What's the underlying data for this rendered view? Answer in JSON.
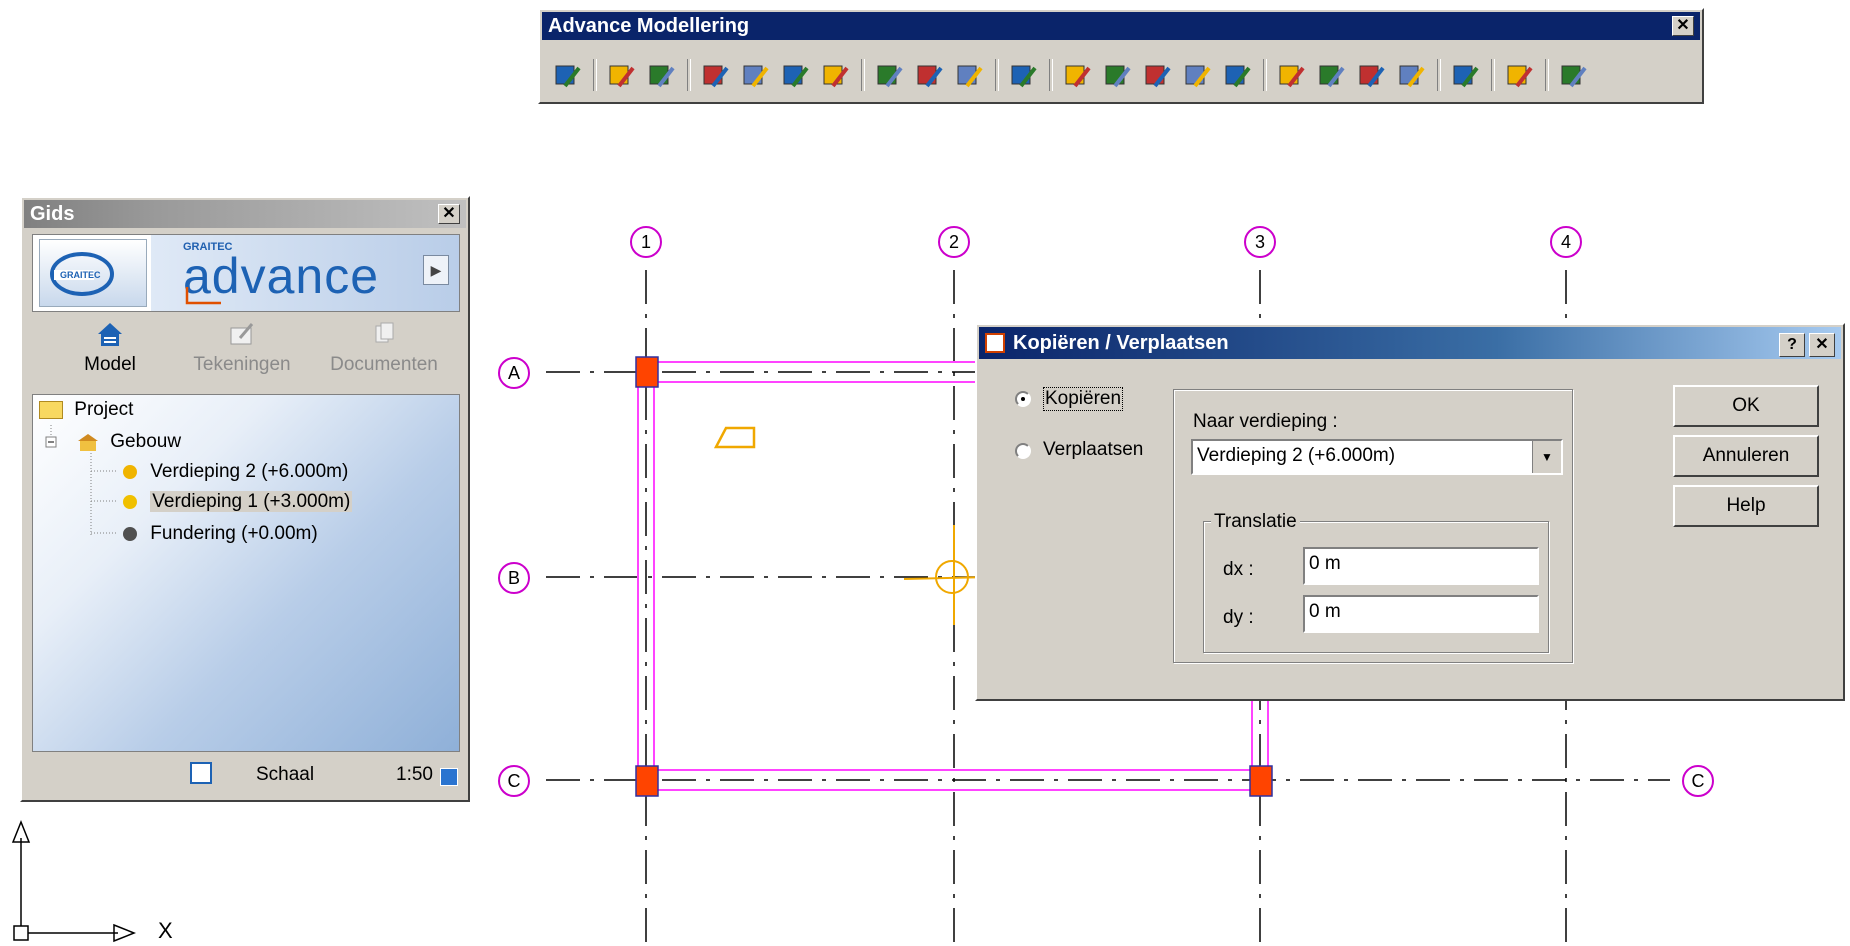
{
  "toolbar": {
    "title": "Advance Modellering",
    "icons": [
      "properties-icon",
      "model-icon",
      "layers-icon",
      "grid-icon",
      "column-icon",
      "beam-icon",
      "wall-icon",
      "roof-icon",
      "slab-icon",
      "foundation-icon",
      "line-load-icon",
      "connect-icon",
      "trim-icon",
      "align-icon",
      "extend-icon",
      "cut-icon",
      "opening-icon",
      "copy-icon",
      "section-icon",
      "stair-icon",
      "house-icon",
      "refresh-icon",
      "check-icon"
    ]
  },
  "gids": {
    "title": "Gids",
    "brand_small": "GRAITEC",
    "brand_big": "advance",
    "tabs": [
      {
        "label": "Model",
        "icon": "model-building-icon"
      },
      {
        "label": "Tekeningen",
        "icon": "drawings-icon"
      },
      {
        "label": "Documenten",
        "icon": "documents-icon"
      }
    ],
    "tree": {
      "project": "Project",
      "gebouw": "Gebouw",
      "levels": [
        {
          "label": "Verdieping 2 (+6.000m)",
          "dot": "#f0b400"
        },
        {
          "label": "Verdieping 1 (+3.000m)",
          "dot": "#f0c000"
        },
        {
          "label": "Fundering (+0.00m)",
          "dot": "#505050"
        }
      ]
    },
    "schaal_label": "Schaal",
    "schaal_value": "1:50"
  },
  "drawing": {
    "columns": [
      "1",
      "2",
      "3",
      "4"
    ],
    "rows": [
      "A",
      "B",
      "C"
    ],
    "row_right": "C",
    "ucs_label": "X",
    "grid_color": "#cc00cc",
    "beam_color": "#ff44ff",
    "column_fill": "#ff4400"
  },
  "dialog": {
    "title": "Kopiëren / Verplaatsen",
    "help_btn": "?",
    "close_btn": "✕",
    "radio_copy": "Kopiëren",
    "radio_move": "Verplaatsen",
    "naar_label": "Naar verdieping :",
    "naar_value": "Verdieping 2 (+6.000m)",
    "translatie_label": "Translatie",
    "dx_label": "dx :",
    "dy_label": "dy :",
    "dx_value": "0 m",
    "dy_value": "0 m",
    "ok": "OK",
    "cancel": "Annuleren",
    "help": "Help"
  }
}
